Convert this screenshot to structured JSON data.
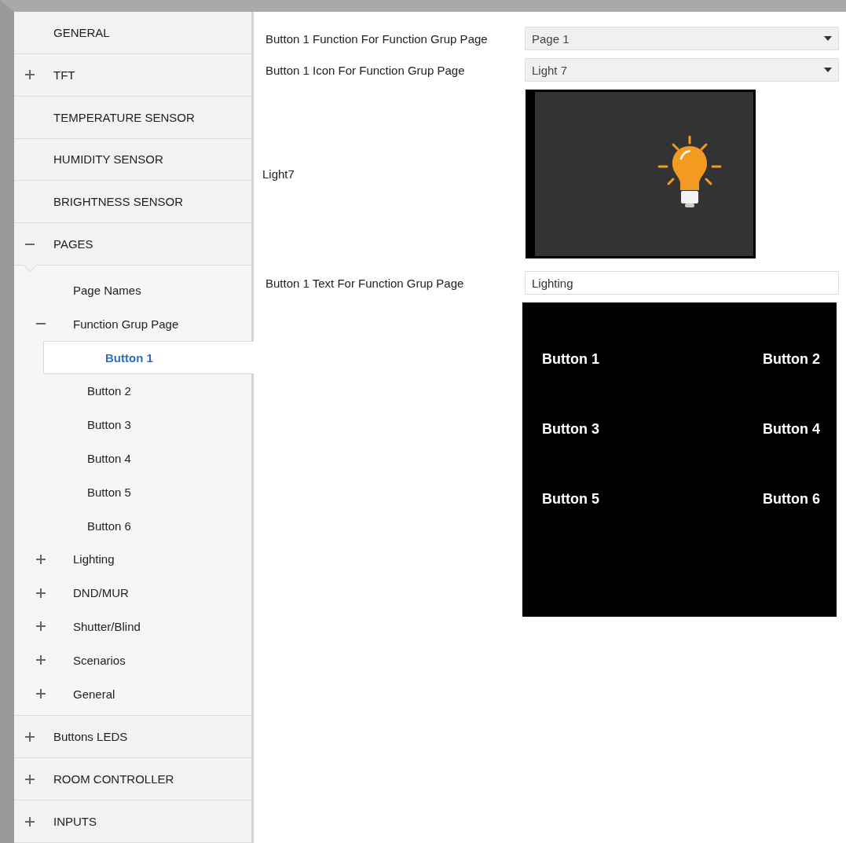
{
  "sidebar": {
    "items": [
      {
        "label": "GENERAL",
        "selected": false
      },
      {
        "label": "TFT",
        "expanded": false,
        "selected": false
      },
      {
        "label": "TEMPERATURE SENSOR",
        "selected": false
      },
      {
        "label": "HUMIDITY SENSOR",
        "selected": false
      },
      {
        "label": "BRIGHTNESS SENSOR",
        "selected": false
      },
      {
        "label": "PAGES",
        "expanded": true,
        "selected": false,
        "children": [
          {
            "label": "Page Names",
            "selected": false
          },
          {
            "label": "Function Grup Page",
            "expanded": true,
            "selected": false,
            "children": [
              {
                "label": "Button 1",
                "selected": true
              },
              {
                "label": "Button 2",
                "selected": false
              },
              {
                "label": "Button 3",
                "selected": false
              },
              {
                "label": "Button 4",
                "selected": false
              },
              {
                "label": "Button 5",
                "selected": false
              },
              {
                "label": "Button 6",
                "selected": false
              }
            ]
          },
          {
            "label": "Lighting",
            "expanded": false,
            "selected": false
          },
          {
            "label": "DND/MUR",
            "expanded": false,
            "selected": false
          },
          {
            "label": "Shutter/Blind",
            "expanded": false,
            "selected": false
          },
          {
            "label": "Scenarios",
            "expanded": false,
            "selected": false
          },
          {
            "label": "General",
            "expanded": false,
            "selected": false
          }
        ]
      },
      {
        "label": "Buttons LEDS",
        "expanded": false,
        "selected": false
      },
      {
        "label": "ROOM CONTROLLER",
        "expanded": false,
        "selected": false
      },
      {
        "label": "INPUTS",
        "expanded": false,
        "selected": false
      }
    ]
  },
  "parameters": [
    {
      "kind": "dropdown",
      "label": "Button 1 Function For Function Grup Page",
      "value": "Page 1"
    },
    {
      "kind": "dropdown",
      "label": "Button 1 Icon For Function Grup Page",
      "value": "Light 7"
    },
    {
      "kind": "icon_preview",
      "label": "Light7"
    },
    {
      "kind": "text",
      "label": "Button 1 Text For Function Grup Page",
      "value": "Lighting"
    },
    {
      "kind": "screen_preview",
      "buttons": [
        "Button 1",
        "Button 2",
        "Button 3",
        "Button 4",
        "Button 5",
        "Button 6"
      ]
    }
  ]
}
